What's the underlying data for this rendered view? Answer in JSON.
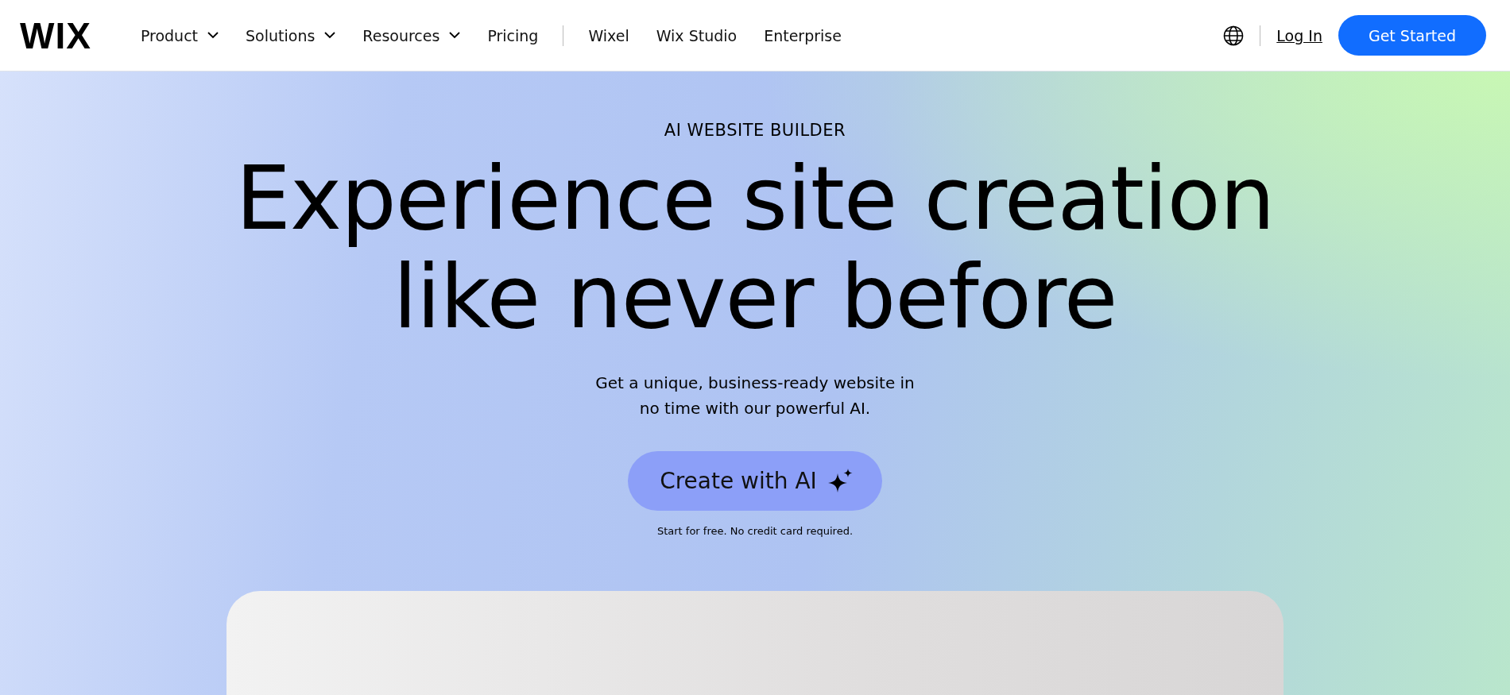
{
  "header": {
    "logo": "WIX",
    "nav": [
      {
        "label": "Product",
        "kind": "dropdown"
      },
      {
        "label": "Solutions",
        "kind": "dropdown"
      },
      {
        "label": "Resources",
        "kind": "dropdown"
      },
      {
        "label": "Pricing",
        "kind": "link"
      }
    ],
    "nav_secondary": [
      {
        "label": "Wixel"
      },
      {
        "label": "Wix Studio"
      },
      {
        "label": "Enterprise"
      }
    ],
    "login": "Log In",
    "cta": "Get Started"
  },
  "hero": {
    "eyebrow": "AI WEBSITE BUILDER",
    "headline_lines": [
      "Experience site creation",
      "like never before"
    ],
    "subtitle_lines": [
      "Get a unique, business-ready website in",
      "no time with our powerful AI."
    ],
    "button": "Create with AI",
    "note": "Start for free. No credit card required."
  }
}
